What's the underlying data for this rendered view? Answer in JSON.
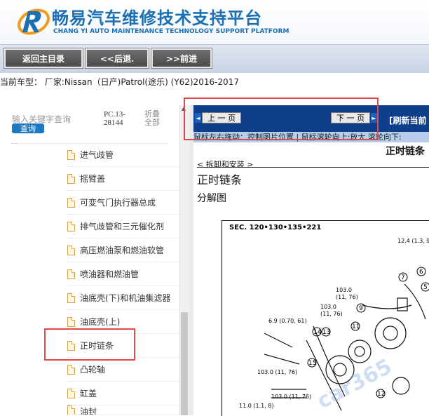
{
  "brand": {
    "title_cn": "畅易汽车维修技术支持平台",
    "title_en": "CHANG YI AUTO MAINTENANCE TECHNOLOGY SUPPORT PLATFORM"
  },
  "toolbar": {
    "home_label": "返回主目录",
    "back_label": "<<后退.",
    "forward_label": ">>前进"
  },
  "vehicle": {
    "text": "当前车型： 厂家:Nissan（日产)Patrol(途乐) (Y62)2016-2017"
  },
  "search": {
    "placeholder": "输入关键字查询",
    "button_label": "查询",
    "code": "PC.13-28144",
    "collapse_all": "折叠全部"
  },
  "tree": {
    "items": [
      {
        "label": "进气歧管"
      },
      {
        "label": "摇臂盖"
      },
      {
        "label": "可变气门执行器总成"
      },
      {
        "label": "排气歧管和三元催化剂"
      },
      {
        "label": "高压燃油泵和燃油软管"
      },
      {
        "label": "喷油器和燃油管"
      },
      {
        "label": "油底壳(下)和机油集滤器"
      },
      {
        "label": "油底壳(上)"
      },
      {
        "label": "正时链条"
      },
      {
        "label": "凸轮轴"
      },
      {
        "label": "缸盖"
      },
      {
        "label": "油封"
      }
    ]
  },
  "nav": {
    "prev_label": "上 一 页",
    "next_label": "下 一 页",
    "refresh_label": "[刷新当前",
    "hint": "鼠标左右拖动：控制图片位置 | 鼠标滚轮向上:放大   滚轮向下:"
  },
  "doc": {
    "section_title": "正时链条",
    "breadcrumb": "< 拆卸和安装 >",
    "title": "正时链条",
    "subtitle": "分解图"
  },
  "diagram": {
    "sec_label": "SEC. 120•130•135•221",
    "torques": [
      "12.4 (1.3, 9",
      "103.0",
      "(11, 76)",
      "103.0",
      "(11, 76)",
      "6.9 (0.70, 61)",
      "103.0 (11, 76)",
      "103.0 (11, 76)",
      "11.0 (1.1, 8)"
    ]
  },
  "colors": {
    "brand_blue": "#1b6fb3",
    "nav_blue": "#0f3f8a",
    "hint_blue": "#b7cdea",
    "highlight_red": "#e04a4a"
  }
}
